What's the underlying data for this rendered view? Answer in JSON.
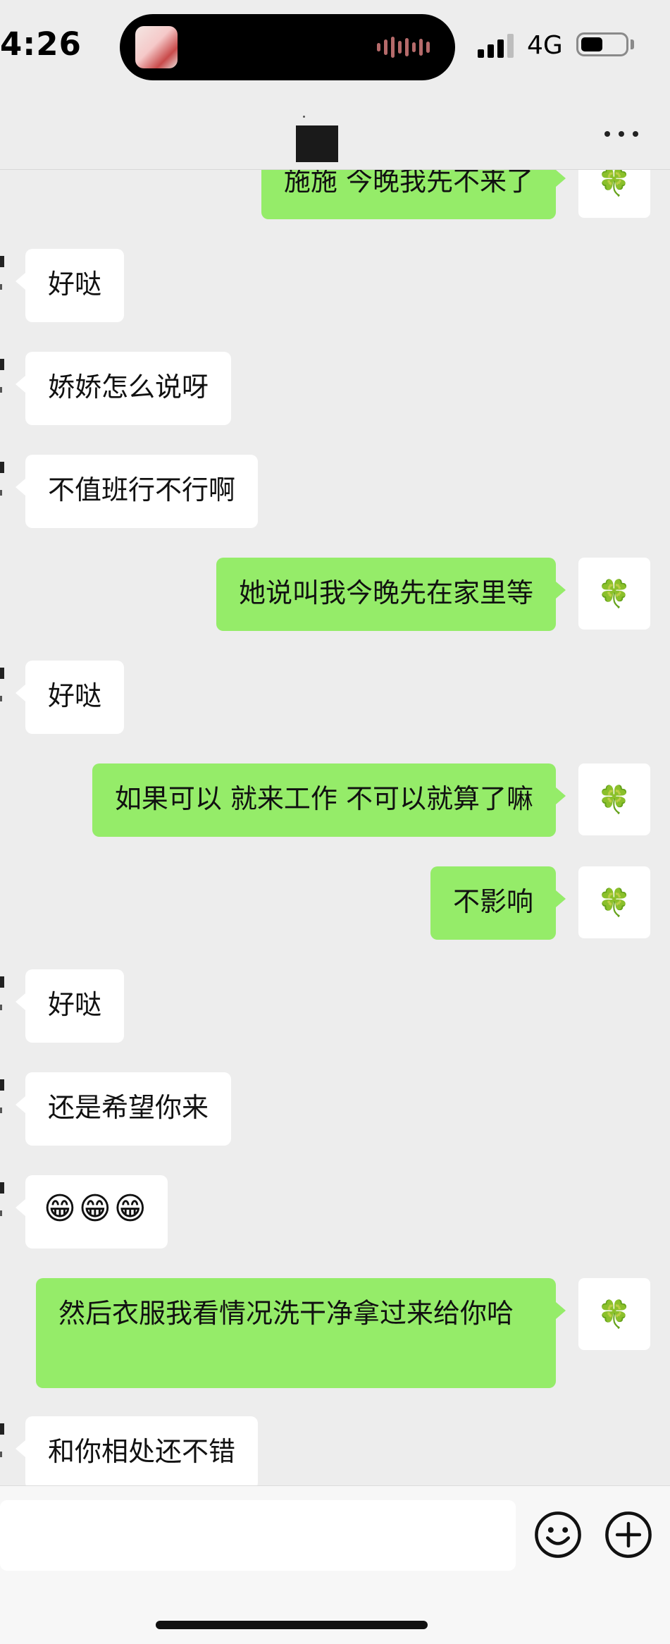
{
  "status_bar": {
    "time": "4:26",
    "network": "4G"
  },
  "messages": [
    {
      "side": "out",
      "text": "施施 今晚我先不来了"
    },
    {
      "side": "in",
      "text": "好哒"
    },
    {
      "side": "in",
      "text": "娇娇怎么说呀"
    },
    {
      "side": "in",
      "text": "不值班行不行啊"
    },
    {
      "side": "out",
      "text": "她说叫我今晚先在家里等"
    },
    {
      "side": "in",
      "text": "好哒"
    },
    {
      "side": "out",
      "text": "如果可以 就来工作 不可以就算了嘛"
    },
    {
      "side": "out",
      "text": "不影响"
    },
    {
      "side": "in",
      "text": "好哒"
    },
    {
      "side": "in",
      "text": "还是希望你来"
    },
    {
      "side": "in",
      "emojis": [
        "😁",
        "😁",
        "😁"
      ]
    },
    {
      "side": "out",
      "text": "然后衣服我看情况洗干净拿过来给你哈"
    },
    {
      "side": "in",
      "text": "和你相处还不错"
    }
  ],
  "icons": {
    "more": "more-icon",
    "self_avatar": "clover-avatar",
    "emoji_button": "smile-icon",
    "plus_button": "plus-icon"
  },
  "colors": {
    "background": "#ededed",
    "outgoing_bubble": "#95ec69",
    "incoming_bubble": "#ffffff"
  }
}
